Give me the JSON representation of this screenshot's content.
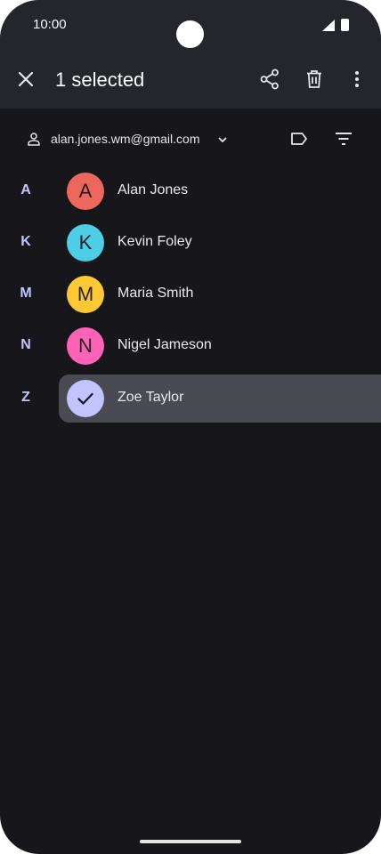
{
  "status": {
    "time": "10:00"
  },
  "appbar": {
    "title": "1 selected"
  },
  "account": {
    "email": "alan.jones.wm@gmail.com"
  },
  "contacts": [
    {
      "letter": "A",
      "name": "Alan Jones",
      "initial": "A",
      "color": "#ee675c",
      "selected": false
    },
    {
      "letter": "K",
      "name": "Kevin Foley",
      "initial": "K",
      "color": "#4ecde6",
      "selected": false
    },
    {
      "letter": "M",
      "name": "Maria Smith",
      "initial": "M",
      "color": "#fcc934",
      "selected": false
    },
    {
      "letter": "N",
      "name": "Nigel Jameson",
      "initial": "N",
      "color": "#ff63b8",
      "selected": false
    },
    {
      "letter": "Z",
      "name": "Zoe Taylor",
      "initial": "",
      "color": "#c2c4ff",
      "selected": true
    }
  ]
}
